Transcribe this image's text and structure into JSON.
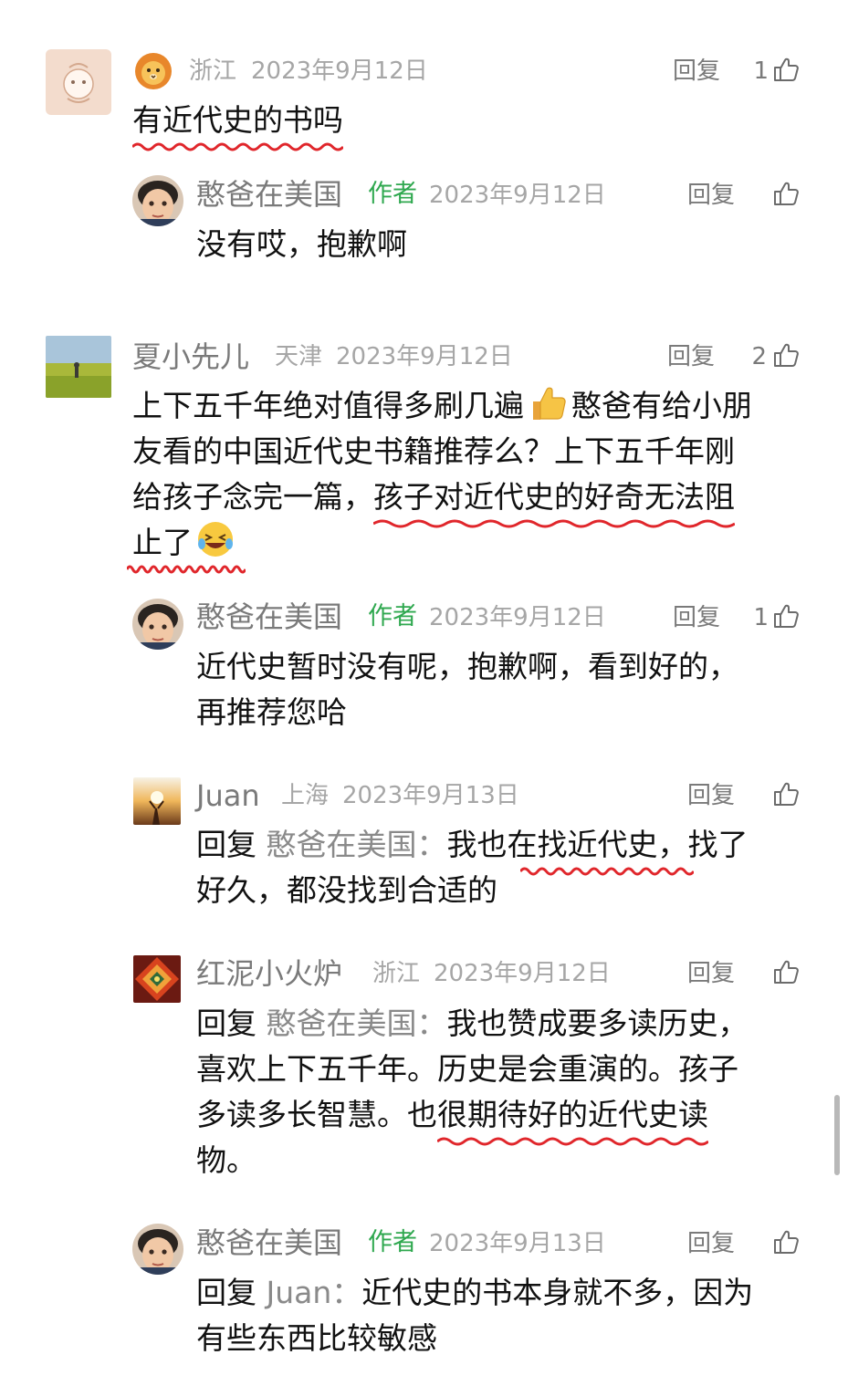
{
  "colors": {
    "author_tag": "#2fa84f",
    "underline": "#e0262b",
    "meta": "#a6a6a6"
  },
  "reply_label": "回复",
  "comments": [
    {
      "location": "浙江",
      "date": "2023年9月12日",
      "likes": "1",
      "line1": "有近代史的书吗",
      "reply": {
        "name": "憨爸在美国",
        "tag": "作者",
        "date": "2023年9月12日",
        "likes": "",
        "line1": "没有哎，抱歉啊"
      }
    },
    {
      "name": "夏小先儿",
      "location": "天津",
      "date": "2023年9月12日",
      "likes": "2",
      "line1": "上下五千年绝对值得多刷几遍",
      "line1b": "憨爸有给小朋",
      "line2": "友看的中国近代史书籍推荐么？上下五千年刚",
      "line3a": "给孩子念完一篇，",
      "line3b": "孩子对近代史的好奇无法阻",
      "line4": "止了"
    }
  ],
  "replies": [
    {
      "name": "憨爸在美国",
      "tag": "作者",
      "date": "2023年9月12日",
      "likes": "1",
      "line1": "近代史暂时没有呢，抱歉啊，看到好的，",
      "line2": "再推荐您哈"
    },
    {
      "name": "Juan",
      "location": "上海",
      "date": "2023年9月13日",
      "likes": "",
      "prefix": "回复",
      "quote": "憨爸在美国：",
      "line1a": "我也在找近代史",
      "line1b": "，找了",
      "line2": "好久，都没找到合适的"
    },
    {
      "name": "红泥小火炉",
      "location": "浙江",
      "date": "2023年9月12日",
      "likes": "",
      "prefix": "回复",
      "quote": "憨爸在美国：",
      "line1": "我也赞成要多读历史，",
      "line2": "喜欢上下五千年。历史是会重演的。孩子",
      "line3a": "多读多长智慧。也",
      "line3b": "很期待好的近代史读",
      "line4": "物。"
    },
    {
      "name": "憨爸在美国",
      "tag": "作者",
      "date": "2023年9月13日",
      "likes": "",
      "prefix": "回复",
      "quote": "Juan：",
      "line1": "近代史的书本身就不多，因为",
      "line2": "有些东西比较敏感"
    }
  ]
}
